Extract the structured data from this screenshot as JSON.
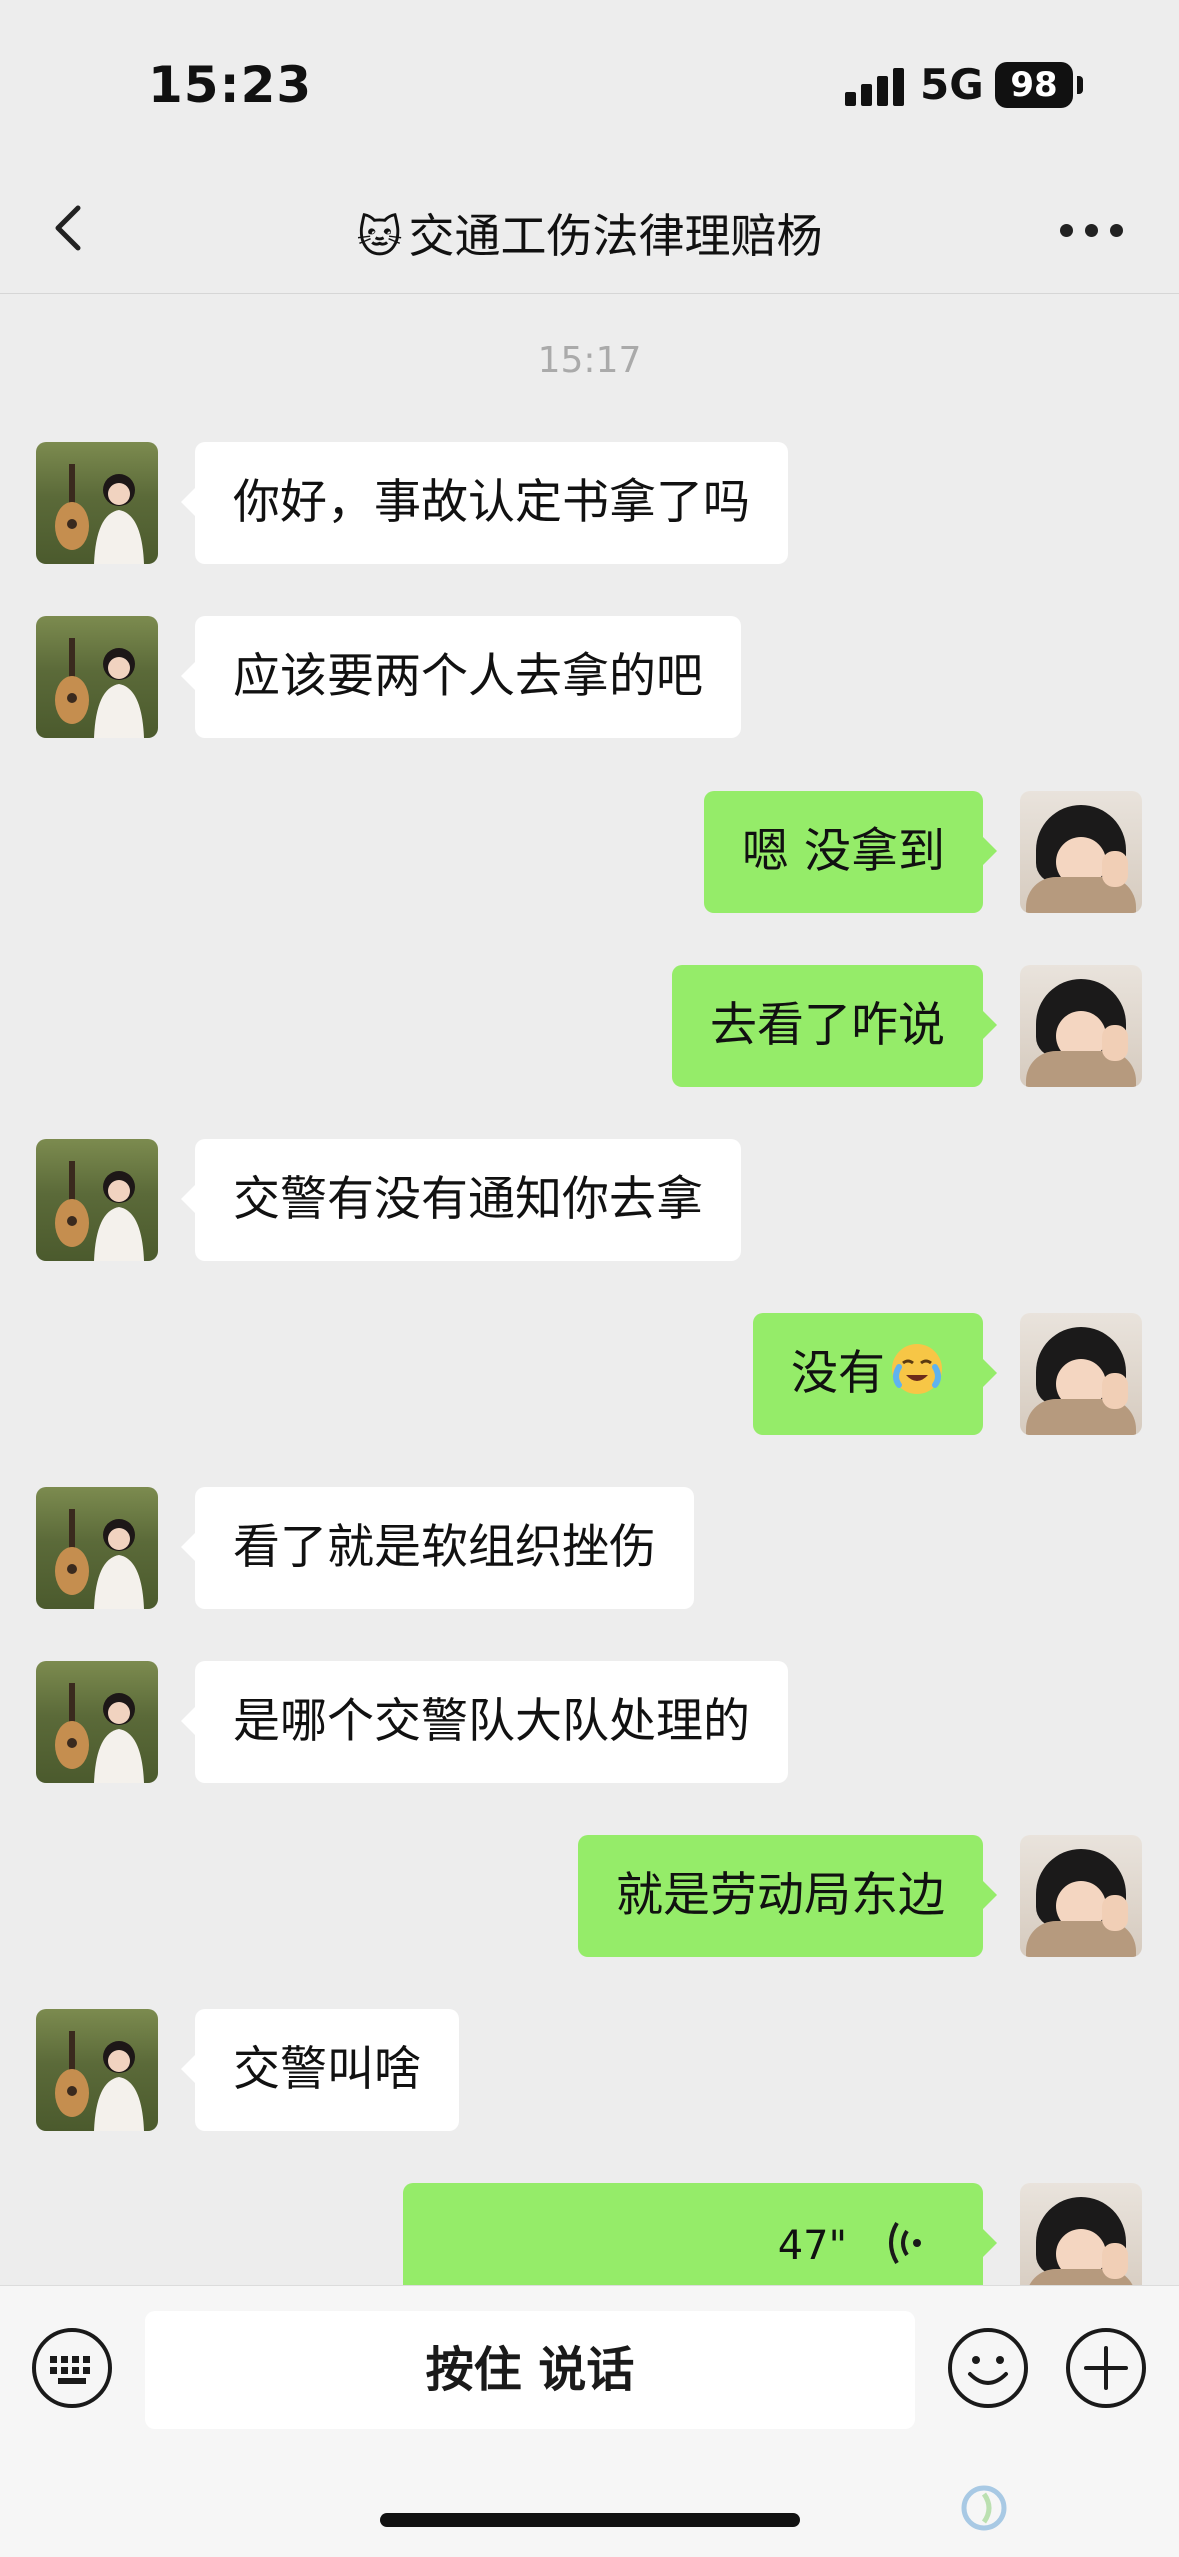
{
  "status_bar": {
    "time": "15:23",
    "network": "5G",
    "battery": "98"
  },
  "nav": {
    "title": "交通工伤法律理赔杨",
    "title_icon": "cat-face-emoji",
    "back_icon": "chevron-left-icon",
    "more_icon": "more-horizontal-icon"
  },
  "timestamp": "15:17",
  "messages": [
    {
      "side": "left",
      "text": "你好，事故认定书拿了吗"
    },
    {
      "side": "left",
      "text": "应该要两个人去拿的吧"
    },
    {
      "side": "right",
      "text": "嗯 没拿到"
    },
    {
      "side": "right",
      "text": "去看了咋说"
    },
    {
      "side": "left",
      "text": "交警有没有通知你去拿"
    },
    {
      "side": "right",
      "text": "没有",
      "emoji": "crying-face-emoji"
    },
    {
      "side": "left",
      "text": "看了就是软组织挫伤"
    },
    {
      "side": "left",
      "text": "是哪个交警队大队处理的"
    },
    {
      "side": "right",
      "text": "就是劳动局东边"
    },
    {
      "side": "left",
      "text": "交警叫啥"
    },
    {
      "side": "right",
      "type": "voice",
      "duration": "47\""
    }
  ],
  "input_bar": {
    "hold_to_talk": "按住 说话",
    "left_icon": "keyboard-icon",
    "emoji_icon": "smiley-icon",
    "plus_icon": "plus-circle-icon"
  },
  "colors": {
    "background": "#ededed",
    "sent_bubble": "#95ec69",
    "received_bubble": "#ffffff"
  }
}
